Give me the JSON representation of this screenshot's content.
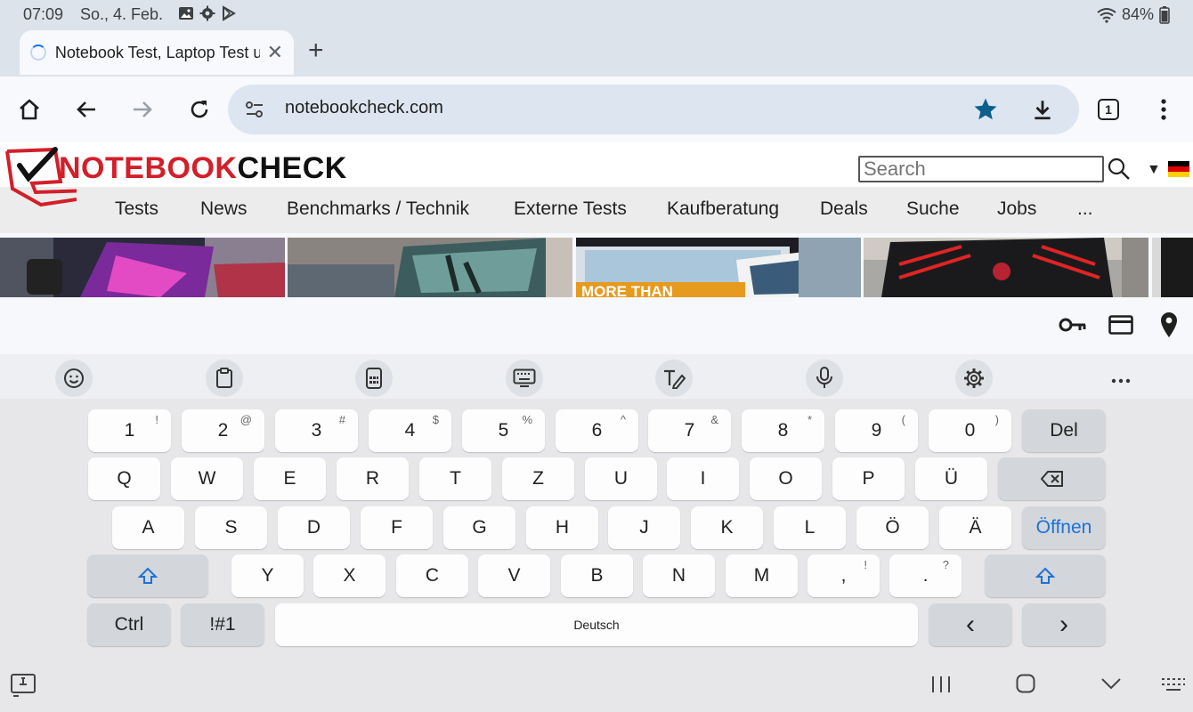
{
  "status_bar": {
    "time": "07:09",
    "date": "So., 4. Feb.",
    "battery": "84%"
  },
  "tab": {
    "title": "Notebook Test, Laptop Test u",
    "close_glyph": "✕",
    "new_tab_glyph": "+"
  },
  "toolbar": {
    "url": "notebookcheck.com",
    "tab_count": "1"
  },
  "site": {
    "logo_part1": "NOTEBOOK",
    "logo_part2": "CHECK",
    "search_placeholder": "Search",
    "nav": [
      "Tests",
      "News",
      "Benchmarks / Technik",
      "Externe Tests",
      "Kaufberatung",
      "Deals",
      "Suche",
      "Jobs",
      "..."
    ],
    "thumb3_caption": "MORE THAN",
    "flag_colors": [
      "#000000",
      "#dd0000",
      "#ffce00"
    ]
  },
  "keyboard": {
    "row1": [
      {
        "label": "1",
        "sup": "!"
      },
      {
        "label": "2",
        "sup": "@"
      },
      {
        "label": "3",
        "sup": "#"
      },
      {
        "label": "4",
        "sup": "$"
      },
      {
        "label": "5",
        "sup": "%"
      },
      {
        "label": "6",
        "sup": "^"
      },
      {
        "label": "7",
        "sup": "&"
      },
      {
        "label": "8",
        "sup": "*"
      },
      {
        "label": "9",
        "sup": "("
      },
      {
        "label": "0",
        "sup": ")"
      }
    ],
    "del_label": "Del",
    "row2": [
      "Q",
      "W",
      "E",
      "R",
      "T",
      "Z",
      "U",
      "I",
      "O",
      "P",
      "Ü"
    ],
    "row3": [
      "A",
      "S",
      "D",
      "F",
      "G",
      "H",
      "J",
      "K",
      "L",
      "Ö",
      "Ä"
    ],
    "enter_label": "Öffnen",
    "row4": [
      "Y",
      "X",
      "C",
      "V",
      "B",
      "N",
      "M"
    ],
    "comma": {
      "label": ",",
      "sup": "!"
    },
    "period": {
      "label": ".",
      "sup": "?"
    },
    "ctrl_label": "Ctrl",
    "symbols_label": "!#1",
    "space_label": "Deutsch",
    "left_label": "‹",
    "right_label": "›",
    "accent_color": "#1b72d9"
  }
}
